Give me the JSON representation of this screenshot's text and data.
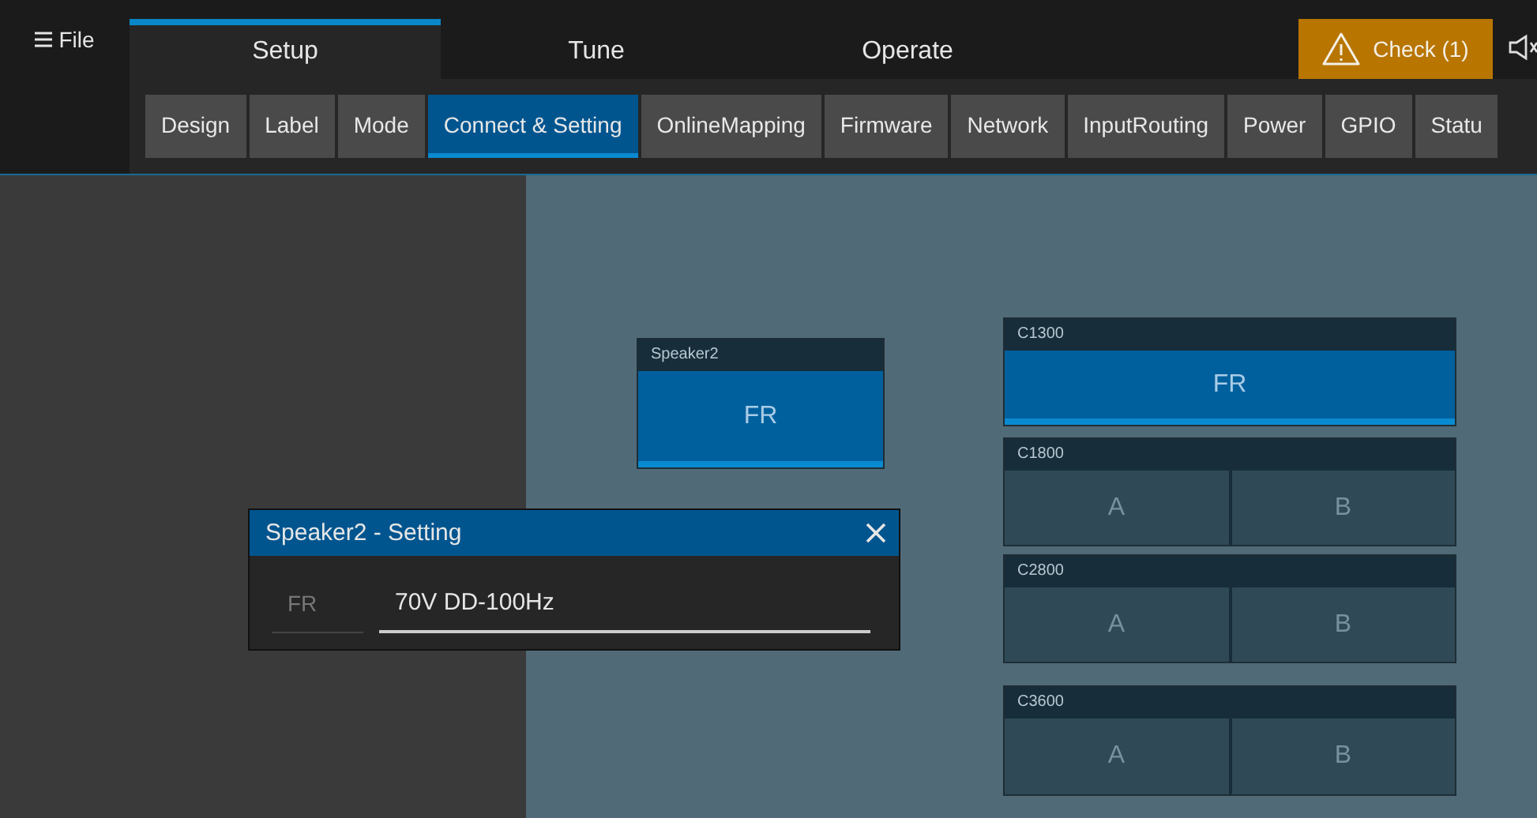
{
  "menu": {
    "label": "File"
  },
  "main_tabs": [
    {
      "label": "Setup",
      "selected": true
    },
    {
      "label": "Tune",
      "selected": false
    },
    {
      "label": "Operate",
      "selected": false
    }
  ],
  "check_button": {
    "label": "Check (1)"
  },
  "sub_tabs": [
    {
      "label": "Design",
      "selected": false
    },
    {
      "label": "Label",
      "selected": false
    },
    {
      "label": "Mode",
      "selected": false
    },
    {
      "label": "Connect & Setting",
      "selected": true
    },
    {
      "label": "OnlineMapping",
      "selected": false
    },
    {
      "label": "Firmware",
      "selected": false
    },
    {
      "label": "Network",
      "selected": false
    },
    {
      "label": "InputRouting",
      "selected": false
    },
    {
      "label": "Power",
      "selected": false
    },
    {
      "label": "GPIO",
      "selected": false
    },
    {
      "label": "Statu",
      "selected": false
    }
  ],
  "speaker": {
    "title": "Speaker2",
    "channel": "FR"
  },
  "amplifiers": [
    {
      "title": "C1300",
      "channels": [
        {
          "label": "FR",
          "assigned": true
        }
      ]
    },
    {
      "title": "C1800",
      "channels": [
        {
          "label": "A",
          "assigned": false
        },
        {
          "label": "B",
          "assigned": false
        }
      ]
    },
    {
      "title": "C2800",
      "channels": [
        {
          "label": "A",
          "assigned": false
        },
        {
          "label": "B",
          "assigned": false
        }
      ]
    },
    {
      "title": "C3600",
      "channels": [
        {
          "label": "A",
          "assigned": false
        },
        {
          "label": "B",
          "assigned": false
        }
      ]
    }
  ],
  "dialog": {
    "title": "Speaker2 - Setting",
    "channel": "FR",
    "value": "70V DD-100Hz"
  }
}
